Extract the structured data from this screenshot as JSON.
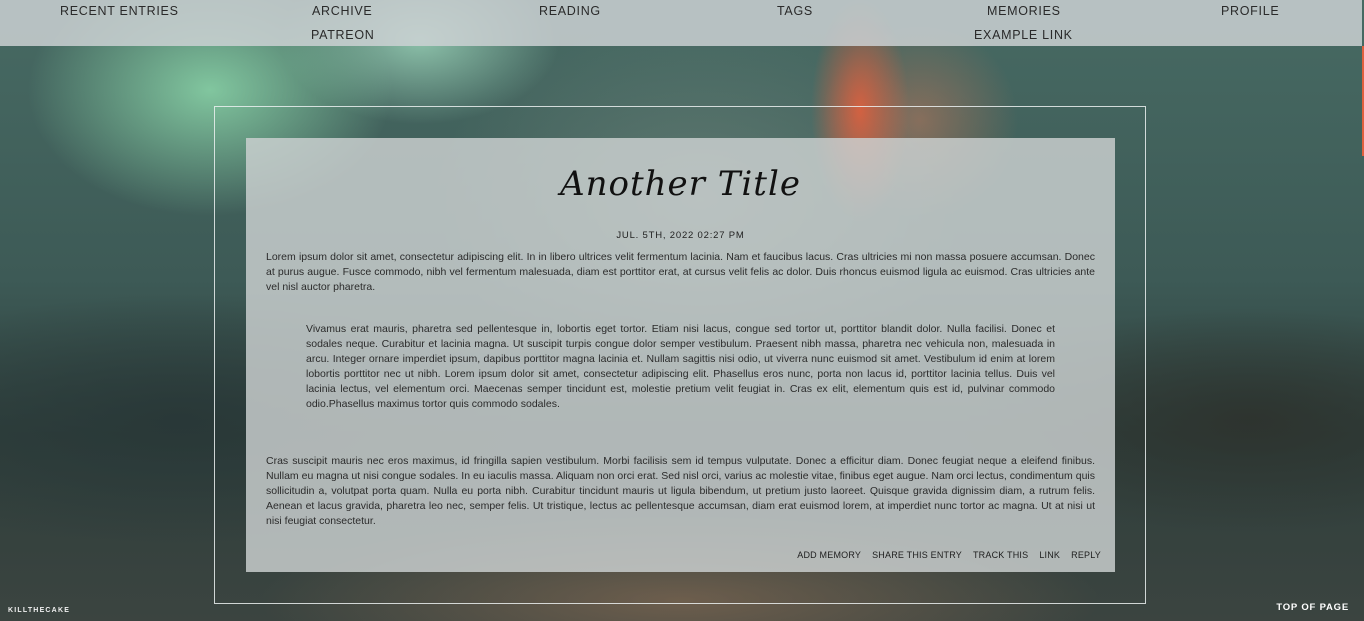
{
  "nav": {
    "items": [
      {
        "label": "RECENT ENTRIES"
      },
      {
        "label": "ARCHIVE"
      },
      {
        "label": "READING"
      },
      {
        "label": "TAGS"
      },
      {
        "label": "MEMORIES"
      },
      {
        "label": "PROFILE"
      },
      {
        "label": "PATREON"
      },
      {
        "label": "EXAMPLE LINK"
      }
    ]
  },
  "entry": {
    "title": "Another Title",
    "date": "JUL. 5TH, 2022 02:27 PM",
    "paragraphs": [
      "Lorem ipsum dolor sit amet, consectetur adipiscing elit. In in libero ultrices velit fermentum lacinia. Nam et faucibus lacus. Cras ultricies mi non massa posuere accumsan. Donec at purus augue. Fusce commodo, nibh vel fermentum malesuada, diam est porttitor erat, at cursus velit felis ac dolor. Duis rhoncus euismod ligula ac euismod. Cras ultricies ante vel nisl auctor pharetra.",
      "Vivamus erat mauris, pharetra sed pellentesque in, lobortis eget tortor. Etiam nisi lacus, congue sed tortor ut, porttitor blandit dolor. Nulla facilisi. Donec et sodales neque. Curabitur et lacinia magna. Ut suscipit turpis congue dolor semper vestibulum. Praesent nibh massa, pharetra nec vehicula non, malesuada in arcu. Integer ornare imperdiet ipsum, dapibus porttitor magna lacinia et. Nullam sagittis nisi odio, ut viverra nunc euismod sit amet. Vestibulum id enim at lorem lobortis porttitor nec ut nibh. Lorem ipsum dolor sit amet, consectetur adipiscing elit. Phasellus eros nunc, porta non lacus id, porttitor lacinia tellus. Duis vel lacinia lectus, vel elementum orci. Maecenas semper tincidunt est, molestie pretium velit feugiat in. Cras ex elit, elementum quis est id, pulvinar commodo odio.Phasellus maximus tortor quis commodo sodales.",
      "Cras suscipit mauris nec eros maximus, id fringilla sapien vestibulum. Morbi facilisis sem id tempus vulputate. Donec a efficitur diam. Donec feugiat neque a eleifend finibus. Nullam eu magna ut nisi congue sodales. In eu iaculis massa. Aliquam non orci erat. Sed nisl orci, varius ac molestie vitae, finibus eget augue. Nam orci lectus, condimentum quis sollicitudin a, volutpat porta quam. Nulla eu porta nibh. Curabitur tincidunt mauris ut ligula bibendum, ut pretium justo laoreet. Quisque gravida dignissim diam, a rutrum felis. Aenean et lacus gravida, pharetra leo nec, semper felis. Ut tristique, lectus ac pellentesque accumsan, diam erat euismod lorem, at imperdiet nunc tortor ac magna. Ut at nisi ut nisi feugiat consectetur."
    ],
    "actions": {
      "add_memory": "ADD MEMORY",
      "share": "SHARE THIS ENTRY",
      "track": "TRACK THIS",
      "link": "LINK",
      "reply": "REPLY"
    }
  },
  "footer": {
    "brand": "KILLTHECAKE",
    "top_of_page": "TOP OF PAGE"
  },
  "colors": {
    "nav_bg": "#cdd2d4",
    "panel_bg": "#cdd2d2",
    "accent_orange": "#e0603e",
    "text_dark": "#2b2b2b"
  }
}
